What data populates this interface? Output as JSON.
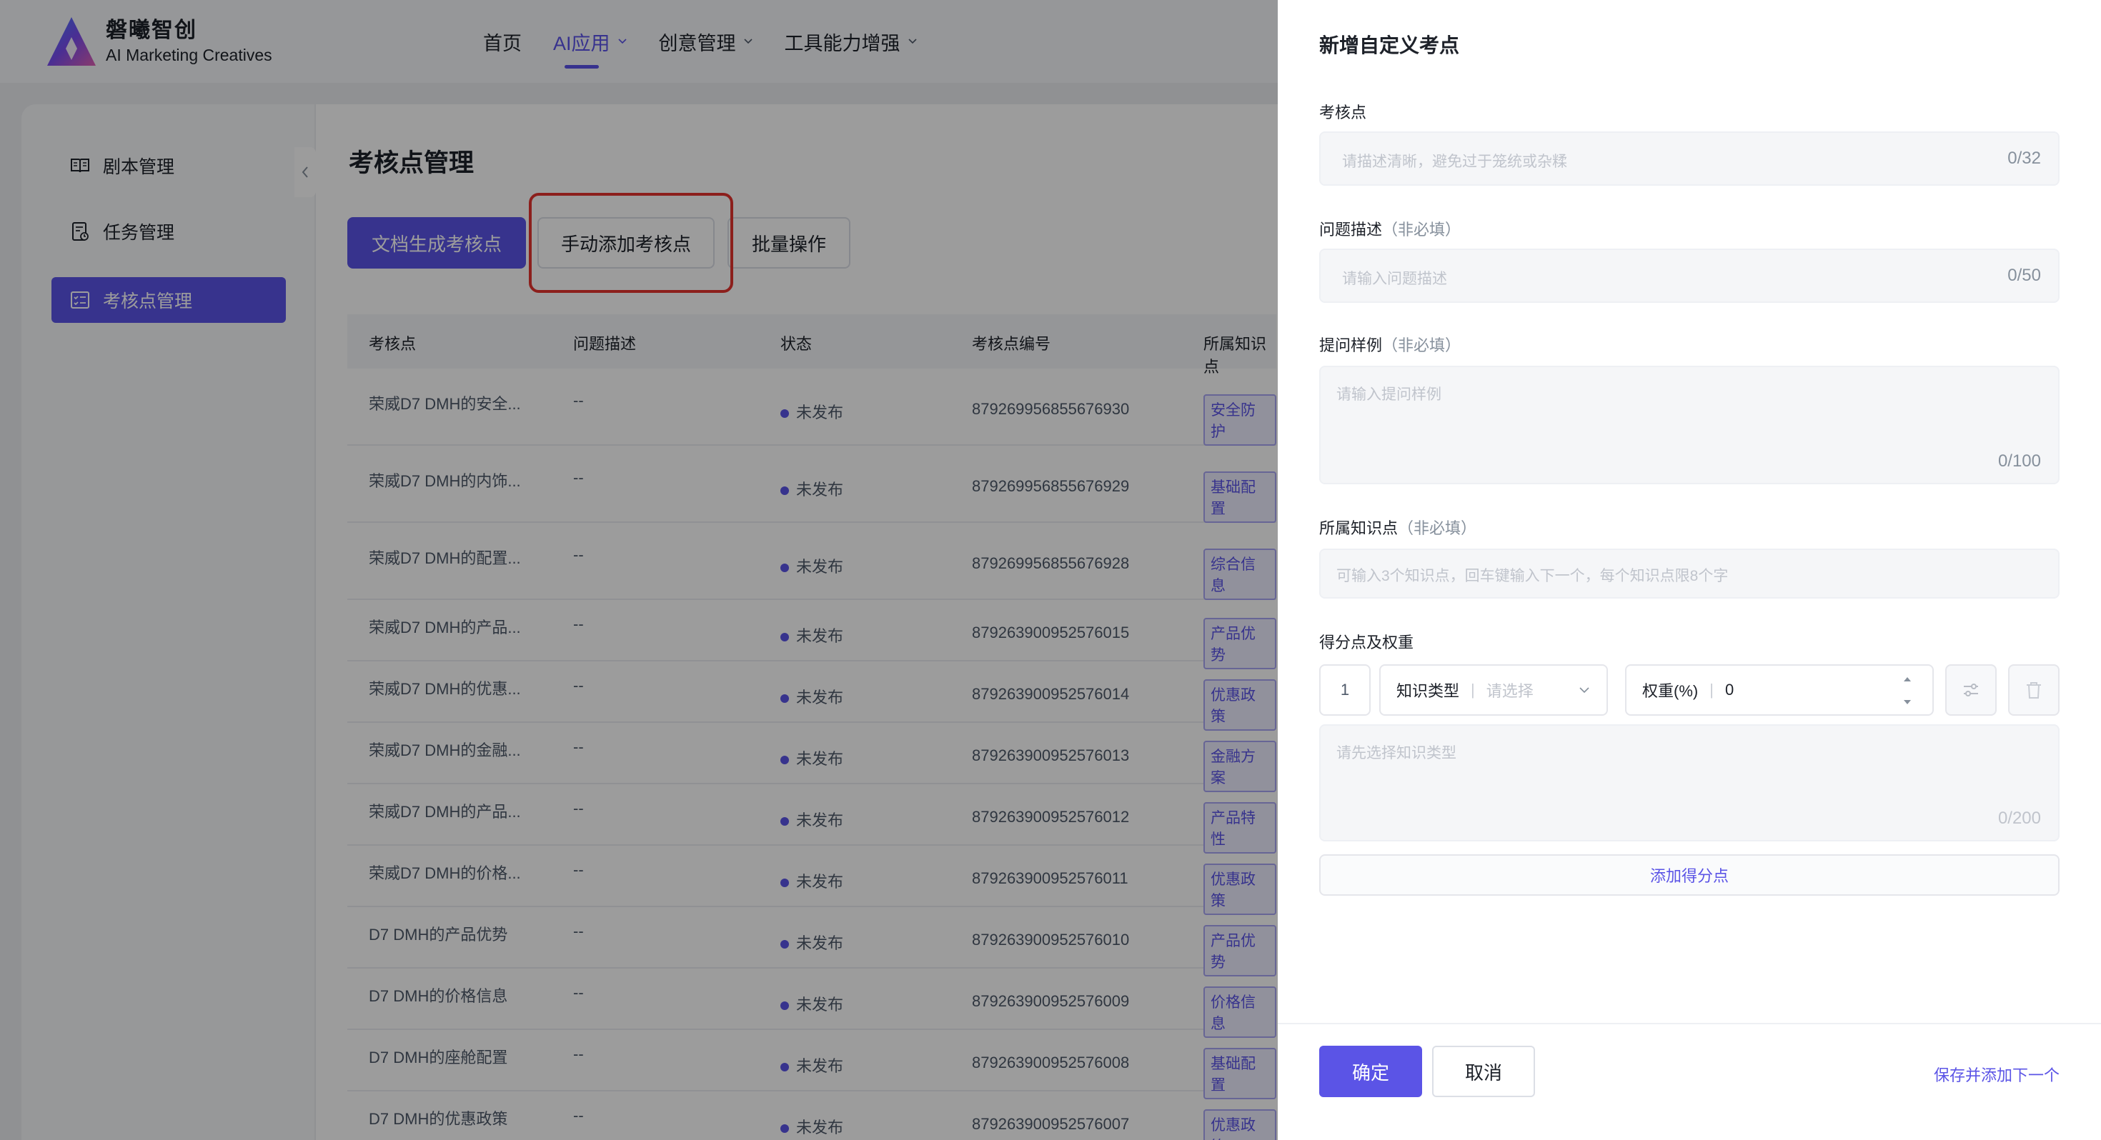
{
  "header": {
    "brand_cn": "磐曦智创",
    "brand_en": "AI Marketing Creatives",
    "nav": [
      "首页",
      "AI应用",
      "创意管理",
      "工具能力增强"
    ],
    "accent": "#5b54e6"
  },
  "sidebar": {
    "items": [
      {
        "label": "剧本管理",
        "icon": "book-icon"
      },
      {
        "label": "任务管理",
        "icon": "task-icon"
      },
      {
        "label": "考核点管理",
        "icon": "checklist-icon"
      }
    ]
  },
  "page": {
    "title": "考核点管理",
    "btn_doc": "文档生成考核点",
    "btn_manual": "手动添加考核点",
    "btn_batch": "批量操作"
  },
  "table": {
    "headers": [
      "考核点",
      "问题描述",
      "状态",
      "考核点编号",
      "所属知识点"
    ],
    "rows": [
      {
        "name": "荣威D7 DMH的安全...",
        "desc": "--",
        "status": "未发布",
        "id": "879269956855676930",
        "tag": "安全防护"
      },
      {
        "name": "荣威D7 DMH的内饰...",
        "desc": "--",
        "status": "未发布",
        "id": "879269956855676929",
        "tag": "基础配置"
      },
      {
        "name": "荣威D7 DMH的配置...",
        "desc": "--",
        "status": "未发布",
        "id": "879269956855676928",
        "tag": "综合信息"
      },
      {
        "name": "荣威D7 DMH的产品...",
        "desc": "--",
        "status": "未发布",
        "id": "879263900952576015",
        "tag": "产品优势"
      },
      {
        "name": "荣威D7 DMH的优惠...",
        "desc": "--",
        "status": "未发布",
        "id": "879263900952576014",
        "tag": "优惠政策"
      },
      {
        "name": "荣威D7 DMH的金融...",
        "desc": "--",
        "status": "未发布",
        "id": "879263900952576013",
        "tag": "金融方案"
      },
      {
        "name": "荣威D7 DMH的产品...",
        "desc": "--",
        "status": "未发布",
        "id": "879263900952576012",
        "tag": "产品特性"
      },
      {
        "name": "荣威D7 DMH的价格...",
        "desc": "--",
        "status": "未发布",
        "id": "879263900952576011",
        "tag": "优惠政策"
      },
      {
        "name": "D7 DMH的产品优势",
        "desc": "--",
        "status": "未发布",
        "id": "879263900952576010",
        "tag": "产品优势"
      },
      {
        "name": "D7 DMH的价格信息",
        "desc": "--",
        "status": "未发布",
        "id": "879263900952576009",
        "tag": "价格信息"
      },
      {
        "name": "D7 DMH的座舱配置",
        "desc": "--",
        "status": "未发布",
        "id": "879263900952576008",
        "tag": "基础配置"
      },
      {
        "name": "D7 DMH的优惠政策",
        "desc": "--",
        "status": "未发布",
        "id": "879263900952576007",
        "tag": "优惠政策"
      }
    ]
  },
  "drawer": {
    "title": "新增自定义考点",
    "optional": "（非必填）",
    "point_label": "考核点",
    "point_ph": "请描述清晰，避免过于笼统或杂糅",
    "point_count": "0/32",
    "desc_label": "问题描述",
    "desc_ph": "请输入问题描述",
    "desc_count": "0/50",
    "example_label": "提问样例",
    "example_ph": "请输入提问样例",
    "example_count": "0/100",
    "kp_label": "所属知识点",
    "kp_ph": "可输入3个知识点，回车键输入下一个，每个知识点限8个字",
    "score_label": "得分点及权重",
    "score_index": "1",
    "type_label": "知识类型",
    "type_ph": "请选择",
    "weight_label": "权重(%)",
    "weight_value": "0",
    "score_ph": "请先选择知识类型",
    "score_count": "0/200",
    "add_score": "添加得分点",
    "ok": "确定",
    "cancel": "取消",
    "save_next": "保存并添加下一个"
  }
}
